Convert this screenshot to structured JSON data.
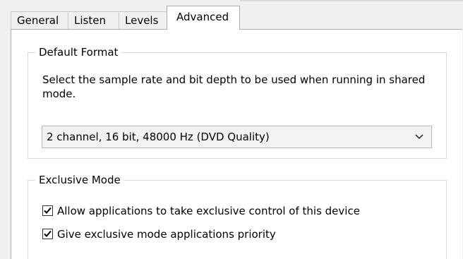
{
  "tabs": [
    {
      "label": "General"
    },
    {
      "label": "Listen"
    },
    {
      "label": "Levels"
    },
    {
      "label": "Advanced",
      "active": true
    }
  ],
  "default_format": {
    "title": "Default Format",
    "description": "Select the sample rate and bit depth to be used when running in shared mode.",
    "selected": "2 channel, 16 bit, 48000 Hz (DVD Quality)",
    "dropdown_icon": "chevron-down-icon"
  },
  "exclusive_mode": {
    "title": "Exclusive Mode",
    "options": [
      {
        "label": "Allow applications to take exclusive control of this device",
        "checked": true,
        "icon": "checkmark-icon"
      },
      {
        "label": "Give exclusive mode applications priority",
        "checked": true,
        "icon": "checkmark-icon"
      }
    ]
  }
}
